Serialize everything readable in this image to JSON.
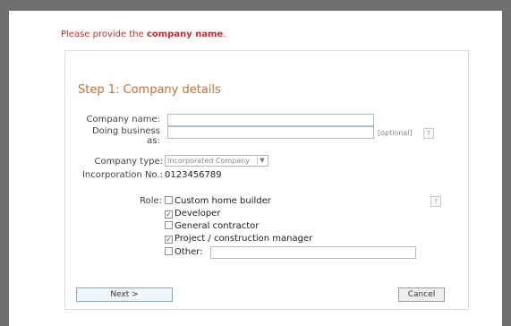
{
  "error": {
    "prefix": "Please provide the ",
    "field": "company name",
    "suffix": "."
  },
  "step": {
    "title": "Step 1: Company details"
  },
  "form": {
    "company_name_label": "Company name:",
    "company_name_value": "",
    "dba_label": "Doing business as:",
    "dba_value": "",
    "optional_text": "[optional]",
    "help_glyph": "?",
    "company_type_label": "Company type:",
    "company_type_selected": "Incorporated Company",
    "incorporation_label": "Incorporation No.:",
    "incorporation_value": "0123456789",
    "role_label": "Role:",
    "roles": [
      {
        "label": "Custom home builder",
        "checked": false
      },
      {
        "label": "Developer",
        "checked": true
      },
      {
        "label": "General contractor",
        "checked": false
      },
      {
        "label": "Project / construction manager",
        "checked": true
      },
      {
        "label": "Other:",
        "checked": false
      }
    ],
    "other_value": ""
  },
  "buttons": {
    "next": "Next >",
    "cancel": "Cancel"
  }
}
